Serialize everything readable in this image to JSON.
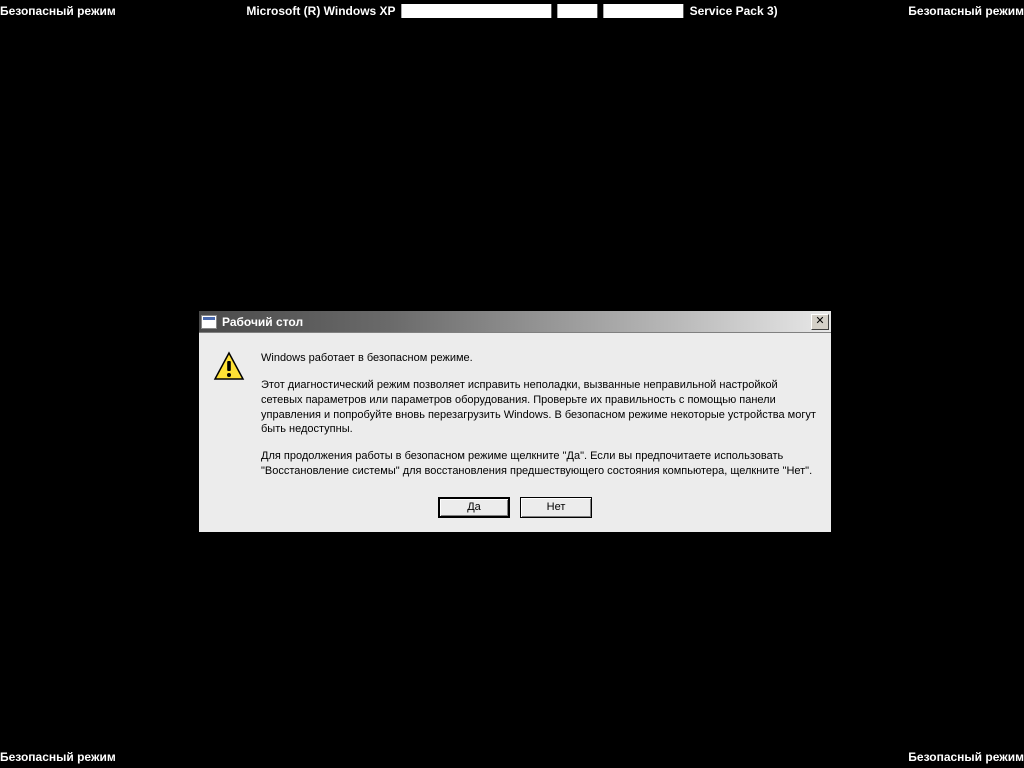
{
  "corners": {
    "top_left": "Безопасный режим",
    "top_right": "Безопасный режим",
    "bottom_left": "Безопасный режим",
    "bottom_right": "Безопасный режим"
  },
  "header": {
    "prefix": "Microsoft (R) Windows XP",
    "suffix": "Service Pack 3)"
  },
  "dialog": {
    "title": "Рабочий стол",
    "close_glyph": "✕",
    "paragraphs": {
      "p1": "Windows работает в безопасном режиме.",
      "p2": "Этот диагностический режим позволяет исправить неполадки, вызванные неправильной настройкой сетевых параметров или параметров оборудования. Проверьте их правильность с помощью панели управления и попробуйте вновь перезагрузить Windows. В безопасном режиме некоторые устройства могут быть недоступны.",
      "p3": "Для продолжения работы в безопасном режиме щелкните \"Да\". Если вы предпочитаете использовать \"Восстановление системы\" для восстановления предшествующего состояния компьютера, щелкните \"Нет\"."
    },
    "buttons": {
      "yes": "Да",
      "no": "Нет"
    }
  }
}
